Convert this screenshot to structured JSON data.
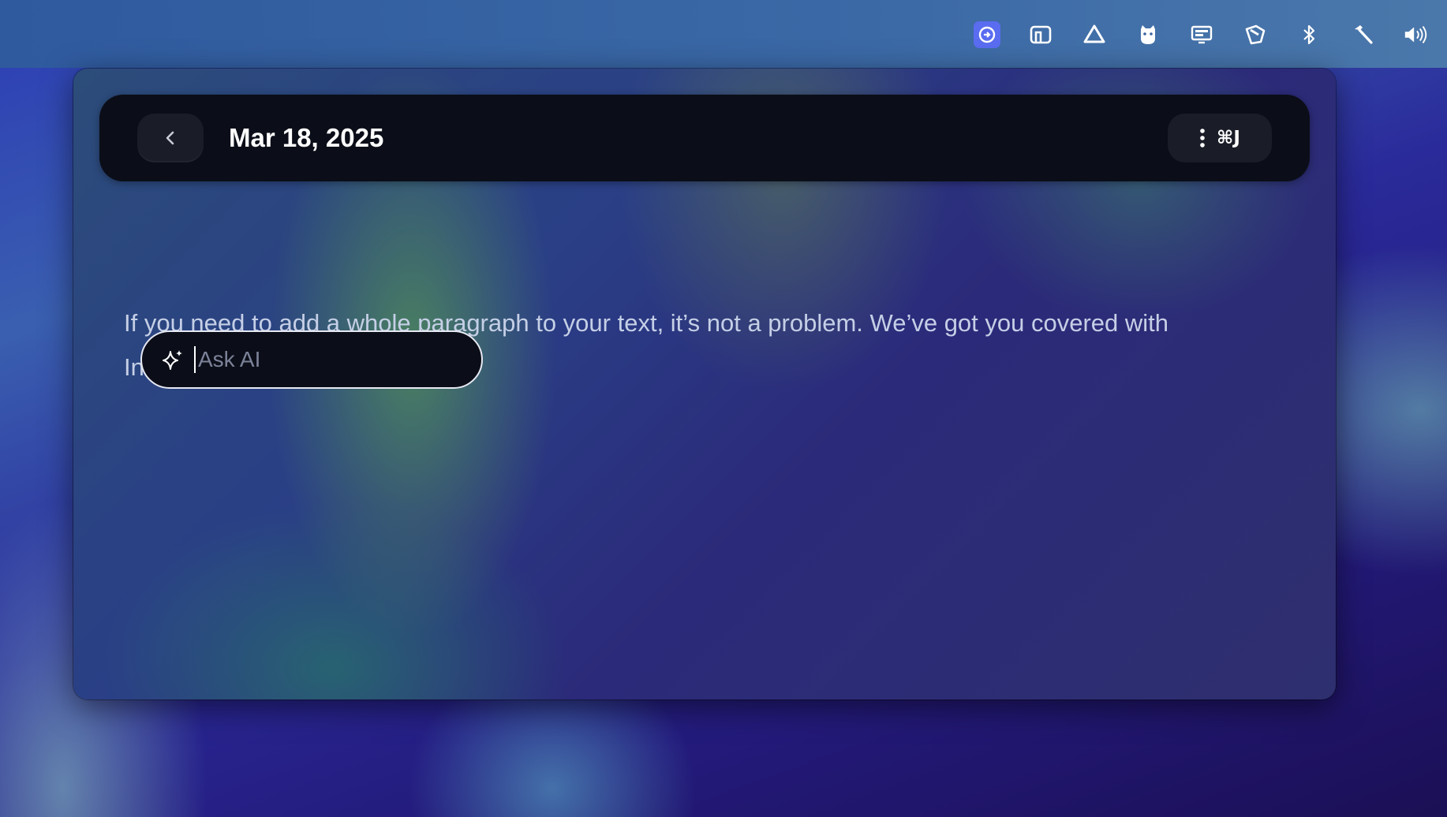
{
  "menubar": {
    "icons": [
      {
        "name": "focus-app-icon",
        "active": true
      },
      {
        "name": "dock-app-icon"
      },
      {
        "name": "triangle-app-icon"
      },
      {
        "name": "cat-app-icon"
      },
      {
        "name": "display-icon"
      },
      {
        "name": "ticket-icon"
      },
      {
        "name": "bluetooth-icon"
      },
      {
        "name": "hammer-icon"
      },
      {
        "name": "volume-icon"
      }
    ]
  },
  "header": {
    "title": "Mar 18, 2025",
    "shortcut": "⌘J"
  },
  "editor": {
    "paragraph": "If you need to add a whole paragraph to your text, it’s not a problem. We’ve got you covered with Inline AI."
  },
  "ask_ai": {
    "placeholder": "Ask AI",
    "value": ""
  },
  "colors": {
    "accent": "#5a6cf0",
    "bar_bg": "#0b0e18",
    "text": "#c5cfe6"
  }
}
